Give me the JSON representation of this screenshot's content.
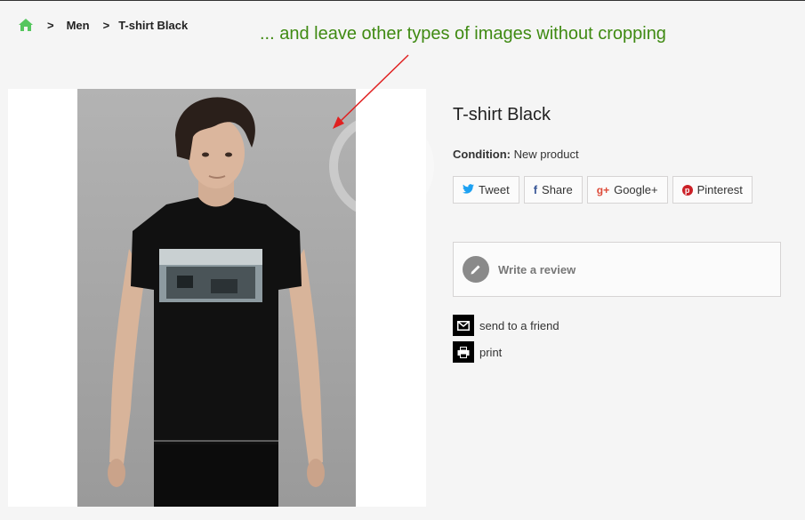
{
  "breadcrumb": {
    "separator": ">",
    "items": [
      {
        "label": "Men"
      },
      {
        "label": "T-shirt Black"
      }
    ]
  },
  "annotation": {
    "text": "... and leave other types of images without cropping",
    "color": "#3f8a12",
    "arrow_color": "#e02020"
  },
  "product": {
    "title": "T-shirt Black",
    "condition_label": "Condition:",
    "condition_value": "New product"
  },
  "share": {
    "buttons": [
      {
        "label": "Tweet",
        "icon": "twitter-icon"
      },
      {
        "label": "Share",
        "icon": "facebook-icon"
      },
      {
        "label": "Google+",
        "icon": "google-plus-icon"
      },
      {
        "label": "Pinterest",
        "icon": "pinterest-icon"
      }
    ]
  },
  "review": {
    "label": "Write a review",
    "icon": "pencil-icon"
  },
  "actions": {
    "send_friend": "send to a friend",
    "print": "print"
  },
  "colors": {
    "home_icon": "#55c65e",
    "background": "#f5f5f5",
    "tshirt": "#111111"
  }
}
